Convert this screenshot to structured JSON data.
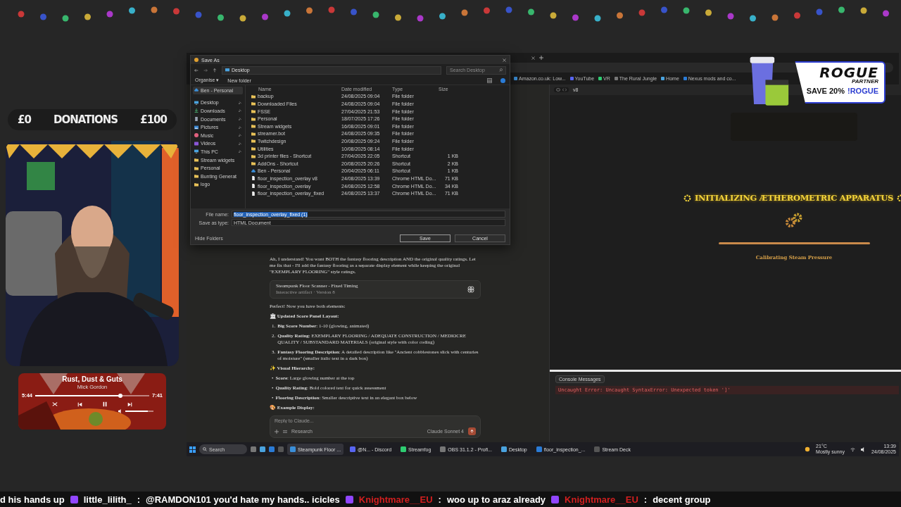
{
  "donations": {
    "start": "£0",
    "title": "DONATIONS",
    "goal": "£100"
  },
  "player": {
    "title": "Rust, Dust & Guts",
    "artist": "Mick Gordon",
    "elapsed": "5:44",
    "total": "7:41",
    "level": 0.75,
    "volume": {
      "level": 0.8
    },
    "playing": true
  },
  "dialog": {
    "title": "Save As",
    "path": "Desktop",
    "search_placeholder": "Search Desktop",
    "organise": "Organise ▾",
    "new_folder": "New folder",
    "nav": [
      {
        "label": "Ben - Personal",
        "kind": "cloud"
      },
      {
        "label": "Desktop",
        "kind": "desktop",
        "pinned": true
      },
      {
        "label": "Downloads",
        "kind": "download",
        "pinned": true
      },
      {
        "label": "Documents",
        "kind": "document",
        "pinned": true
      },
      {
        "label": "Pictures",
        "kind": "pictures",
        "pinned": true
      },
      {
        "label": "Music",
        "kind": "music",
        "pinned": true
      },
      {
        "label": "Videos",
        "kind": "videos",
        "pinned": true
      },
      {
        "label": "This PC",
        "kind": "desktop",
        "pinned": true
      },
      {
        "label": "Stream widgets",
        "kind": "folder",
        "pinned": false
      },
      {
        "label": "Personal",
        "kind": "folder",
        "pinned": false
      },
      {
        "label": "Bunting Generat",
        "kind": "folder",
        "pinned": false
      },
      {
        "label": "logo",
        "kind": "folder",
        "pinned": false
      }
    ],
    "columns": [
      "Name",
      "Date modified",
      "Type",
      "Size"
    ],
    "rows": [
      {
        "name": "backup",
        "date": "24/08/2025 09:04",
        "type": "File folder",
        "size": "",
        "kind": "folder"
      },
      {
        "name": "Downloaded Files",
        "date": "24/08/2025 09:04",
        "type": "File folder",
        "size": "",
        "kind": "folder"
      },
      {
        "name": "FSSE",
        "date": "27/04/2025 21:53",
        "type": "File folder",
        "size": "",
        "kind": "folder"
      },
      {
        "name": "Personal",
        "date": "18/07/2025 17:26",
        "type": "File folder",
        "size": "",
        "kind": "folder"
      },
      {
        "name": "Stream widgets",
        "date": "16/08/2025 09:01",
        "type": "File folder",
        "size": "",
        "kind": "folder"
      },
      {
        "name": "streamer.bot",
        "date": "24/08/2025 09:35",
        "type": "File folder",
        "size": "",
        "kind": "folder"
      },
      {
        "name": "Twitchdesign",
        "date": "20/08/2025 09:24",
        "type": "File folder",
        "size": "",
        "kind": "folder"
      },
      {
        "name": "Utilities",
        "date": "10/08/2025 08:14",
        "type": "File folder",
        "size": "",
        "kind": "folder"
      },
      {
        "name": "3d printer files - Shortcut",
        "date": "27/04/2025 22:05",
        "type": "Shortcut",
        "size": "1 KB",
        "kind": "folder"
      },
      {
        "name": "AddOns - Shortcut",
        "date": "20/08/2025 20:26",
        "type": "Shortcut",
        "size": "2 KB",
        "kind": "folder"
      },
      {
        "name": "Ben - Personal",
        "date": "20/04/2025 06:11",
        "type": "Shortcut",
        "size": "1 KB",
        "kind": "cloud"
      },
      {
        "name": "floor_inspection_overlay v8",
        "date": "24/08/2025 13:39",
        "type": "Chrome HTML Do...",
        "size": "71 KB",
        "kind": "file"
      },
      {
        "name": "floor_inspection_overlay",
        "date": "24/08/2025 12:58",
        "type": "Chrome HTML Do...",
        "size": "34 KB",
        "kind": "file"
      },
      {
        "name": "floor_inspection_overlay_fixed",
        "date": "24/08/2025 13:37",
        "type": "Chrome HTML Do...",
        "size": "71 KB",
        "kind": "file"
      }
    ],
    "file_name_label": "File name:",
    "file_name": "floor_inspection_overlay_fixed (1)",
    "type_label": "Save as type:",
    "file_type": "HTML Document",
    "hide_folders": "Hide Folders",
    "save": "Save",
    "cancel": "Cancel"
  },
  "bookmarks": [
    "Amazon.co.uk: Low...",
    "YouTube",
    "VR",
    "The Rural Jungle",
    "Home",
    "Nexus mods and co..."
  ],
  "chat": {
    "intro": "Ah, I understand! You want BOTH the fantasy flooring description AND the original quality ratings. Let me fix that - I'll add the fantasy flooring as a separate display element while keeping the original \"EXEMPLARY FLOORING\" style ratings.",
    "artifact": {
      "title": "Steampunk Floor Scanner - Fixed Timing",
      "meta": "Interactive artifact · Version 8"
    },
    "lead": "Perfect! Now you have both elements:",
    "sections": [
      {
        "emoji": "🏛",
        "heading": "Updated Score Panel Layout:",
        "items": [
          {
            "marker": "1.",
            "text": "**Big Score Number**: 1-10 (glowing, animated)"
          },
          {
            "marker": "2.",
            "text": "**Quality Rating**: EXEMPLARY FLOORING / ADEQUATE CONSTRUCTION / MEDIOCRE QUALITY / SUBSTANDARD MATERIALS (original style with color coding)"
          },
          {
            "marker": "3.",
            "text": "**Fantasy Flooring Description**: A detailed description like \"Ancient cobblestones slick with centuries of moisture\" (smaller italic text in a dark box)"
          }
        ]
      },
      {
        "emoji": "✨",
        "heading": "Visual Hierarchy:",
        "items": [
          {
            "marker": "•",
            "text": "**Score**: Large glowing number at the top"
          },
          {
            "marker": "•",
            "text": "**Quality Rating**: Bold colored text for quick assessment"
          },
          {
            "marker": "•",
            "text": "**Flooring Description**: Smaller descriptive text in an elegant box below"
          }
        ]
      },
      {
        "emoji": "🎨",
        "heading": "Example Display:"
      }
    ],
    "placeholder": "Reply to Claude...",
    "research": "Research",
    "model": "Claude Sonnet 4"
  },
  "preview": {
    "version": "v8",
    "heading": "INITIALIZING ÆTHEROMETRIC APPARATUS",
    "level": 1,
    "status": "Calibrating Steam Pressure",
    "console_button": "Console Messages",
    "error": "Uncaught Error: Uncaught SyntaxError: Unexpected token ']'"
  },
  "ad": {
    "brand": "ROGUE",
    "tag": "PARTNER",
    "offer": "SAVE 20%",
    "code": "!ROGUE"
  },
  "taskbar": {
    "search": "Search",
    "apps": [
      "Steampunk Floor ...",
      "@N... - Discord",
      "Streamfog",
      "OBS 31.1.2 - Profi...",
      "Desktop",
      "floor_inspection_...",
      "Stream Deck"
    ],
    "temp": "21°C",
    "weather": "Mostly sunny",
    "time": "13:39",
    "date": "24/08/2025"
  },
  "ticker": {
    "lead": "d his hands up",
    "messages": [
      {
        "user": "little_lilith_",
        "color": "#ffffff",
        "separator": ":",
        "text": "@RAMDON101 you'd hate my hands.. icicles"
      },
      {
        "user": "Knightmare__EU",
        "color": "#d21f1f",
        "separator": ":",
        "text": "woo up to araz already"
      },
      {
        "user": "Knightmare__EU",
        "color": "#d21f1f",
        "separator": ":",
        "text": "decent group"
      }
    ]
  }
}
